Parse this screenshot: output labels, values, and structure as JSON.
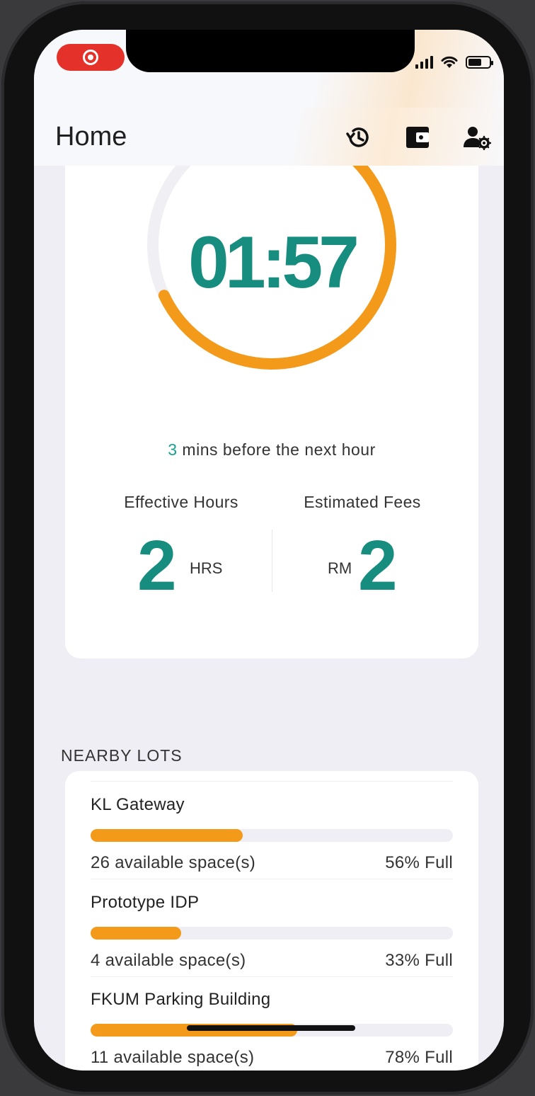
{
  "header": {
    "title": "Home",
    "icons": [
      "history-icon",
      "wallet-icon",
      "user-settings-icon"
    ]
  },
  "timer": {
    "display": "01:57",
    "ring_progress_percent": 68,
    "ring_color": "#f49a1a",
    "text_color": "#168d7f"
  },
  "next_hour": {
    "minutes": "3",
    "suffix": " mins before the next hour"
  },
  "stats": {
    "effective_hours": {
      "label": "Effective Hours",
      "value": "2",
      "unit": "HRS"
    },
    "estimated_fees": {
      "label": "Estimated Fees",
      "currency": "RM",
      "value": "2"
    }
  },
  "nearby": {
    "title": "NEARBY LOTS",
    "lots": [
      {
        "name": "KL Gateway",
        "available": "26 available space(s)",
        "full": "56% Full",
        "fill_fraction": 0.42
      },
      {
        "name": "Prototype IDP",
        "available": "4 available space(s)",
        "full": "33% Full",
        "fill_fraction": 0.25
      },
      {
        "name": "FKUM Parking Building",
        "available": "11 available space(s)",
        "full": "78% Full",
        "fill_fraction": 0.57
      }
    ]
  },
  "colors": {
    "accent": "#f49a1a",
    "teal": "#168d7f",
    "background": "#efeef4"
  }
}
